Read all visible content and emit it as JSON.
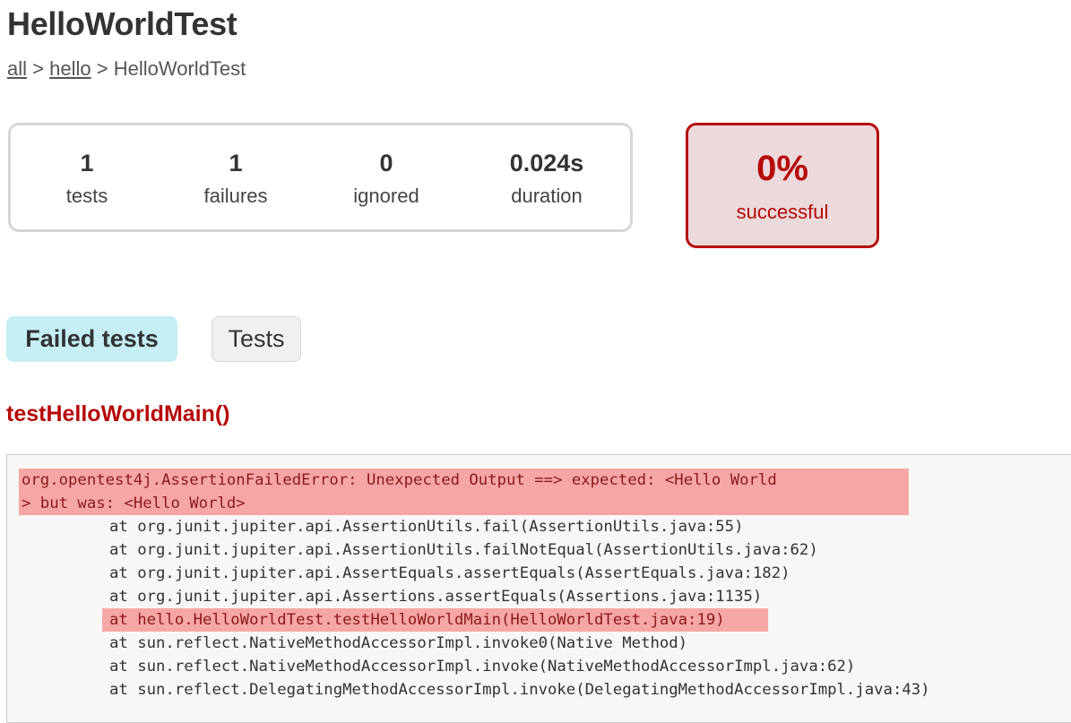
{
  "header": {
    "title": "HelloWorldTest",
    "breadcrumb": [
      {
        "label": "all",
        "link": true
      },
      {
        "label": "hello",
        "link": true
      },
      {
        "label": "HelloWorldTest",
        "link": false
      }
    ],
    "separator": ">"
  },
  "summary": {
    "counters": [
      {
        "value": "1",
        "label": "tests"
      },
      {
        "value": "1",
        "label": "failures"
      },
      {
        "value": "0",
        "label": "ignored"
      },
      {
        "value": "0.024s",
        "label": "duration"
      }
    ],
    "success_rate": {
      "value": "0%",
      "label": "successful",
      "status": "failed"
    }
  },
  "colors": {
    "failure": "#b60808",
    "failure_bg": "#ecd9db",
    "active_tab_bg": "#c5eff5",
    "highlight": "#f7a6a6"
  },
  "tabs": [
    {
      "label": "Failed tests",
      "active": true
    },
    {
      "label": "Tests",
      "active": false
    }
  ],
  "failed_test": {
    "name": "testHelloWorldMain()",
    "stacktrace": [
      {
        "text": "org.opentest4j.AssertionFailedError: Unexpected Output ==> expected: <Hello World",
        "highlight": true
      },
      {
        "text": "> but was: <Hello World>",
        "highlight": true
      },
      {
        "text": "\tat org.junit.jupiter.api.AssertionUtils.fail(AssertionUtils.java:55)",
        "highlight": false
      },
      {
        "text": "\tat org.junit.jupiter.api.AssertionUtils.failNotEqual(AssertionUtils.java:62)",
        "highlight": false
      },
      {
        "text": "\tat org.junit.jupiter.api.AssertEquals.assertEquals(AssertEquals.java:182)",
        "highlight": false
      },
      {
        "text": "\tat org.junit.jupiter.api.Assertions.assertEquals(Assertions.java:1135)",
        "highlight": false
      },
      {
        "text": "\tat hello.HelloWorldTest.testHelloWorldMain(HelloWorldTest.java:19)",
        "highlight": true
      },
      {
        "text": "\tat sun.reflect.NativeMethodAccessorImpl.invoke0(Native Method)",
        "highlight": false
      },
      {
        "text": "\tat sun.reflect.NativeMethodAccessorImpl.invoke(NativeMethodAccessorImpl.java:62)",
        "highlight": false
      },
      {
        "text": "\tat sun.reflect.DelegatingMethodAccessorImpl.invoke(DelegatingMethodAccessorImpl.java:43)",
        "highlight": false
      }
    ]
  }
}
